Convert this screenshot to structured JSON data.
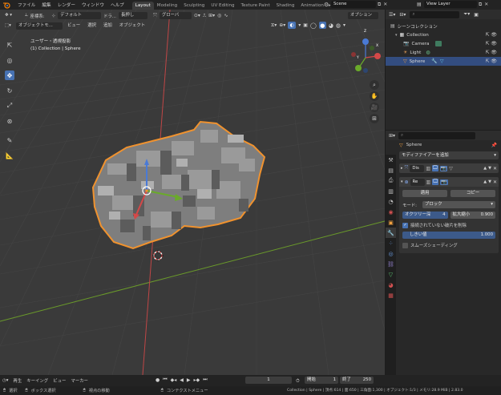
{
  "colors": {
    "selection": "#f0922e",
    "active_tool": "#4772b3",
    "x_axis": "#c04646",
    "y_axis": "#6a9a2a",
    "outliner_selected": "#334d80"
  },
  "menu": [
    "ファイル",
    "編集",
    "レンダー",
    "ウィンドウ",
    "ヘルプ"
  ],
  "workspaces": [
    "Layout",
    "Modeling",
    "Sculpting",
    "UV Editing",
    "Texture Paint",
    "Shading",
    "Animation"
  ],
  "scene": {
    "name": "Scene",
    "view_layer": "View Layer"
  },
  "tool_header": {
    "coord_label": "座標系:",
    "orientation": "デフォルト",
    "drag": "ドラ...",
    "drag_mode": "長押し",
    "global": "グローバ",
    "options": "オプション"
  },
  "viewport_header": {
    "mode": "オブジェクトモ...",
    "menus": [
      "ビュー",
      "選択",
      "追加",
      "オブジェクト"
    ]
  },
  "viewport": {
    "view_name": "ユーザー・透視投影",
    "collection_info": "(1) Collection | Sphere"
  },
  "gizmo_axes": [
    "X",
    "Y",
    "Z"
  ],
  "outliner": {
    "root": "シーンコレクション",
    "collection": "Collection",
    "items": [
      "Camera",
      "Light",
      "Sphere"
    ]
  },
  "properties": {
    "object_name": "Sphere",
    "add_modifier": "モディファイアーを追加",
    "mod1_name": "Dis",
    "mod2_name": "Re",
    "apply": "適用",
    "copy": "コピー",
    "mode_label": "モード:",
    "mode_value": "ブロック",
    "octree_label": "オクツリー深",
    "octree_value": "4",
    "scale_label": "拡大縮小",
    "scale_value": "0.900",
    "remove_disconnected": "接続されていない破片を削除",
    "threshold_label": "しきい値",
    "threshold_value": "1.000",
    "smooth_shading": "スムーズシェーディング"
  },
  "timeline": {
    "playback": "再生",
    "keying": "キーイング",
    "view": "ビュー",
    "marker": "マーカー",
    "current_frame": "1",
    "start_label": "開始",
    "start": "1",
    "end_label": "終了",
    "end": "250"
  },
  "status": {
    "select": "選択",
    "box_select": "ボックス選択",
    "move_view": "視点の移動",
    "context_menu": "コンテクストメニュー",
    "stats": "Collection | Sphere | 頂点:614 | 面:650 | 三角面:1,300 | オブジェクト:1/3 | メモリ:28.9 MiB | 2.83.0"
  }
}
